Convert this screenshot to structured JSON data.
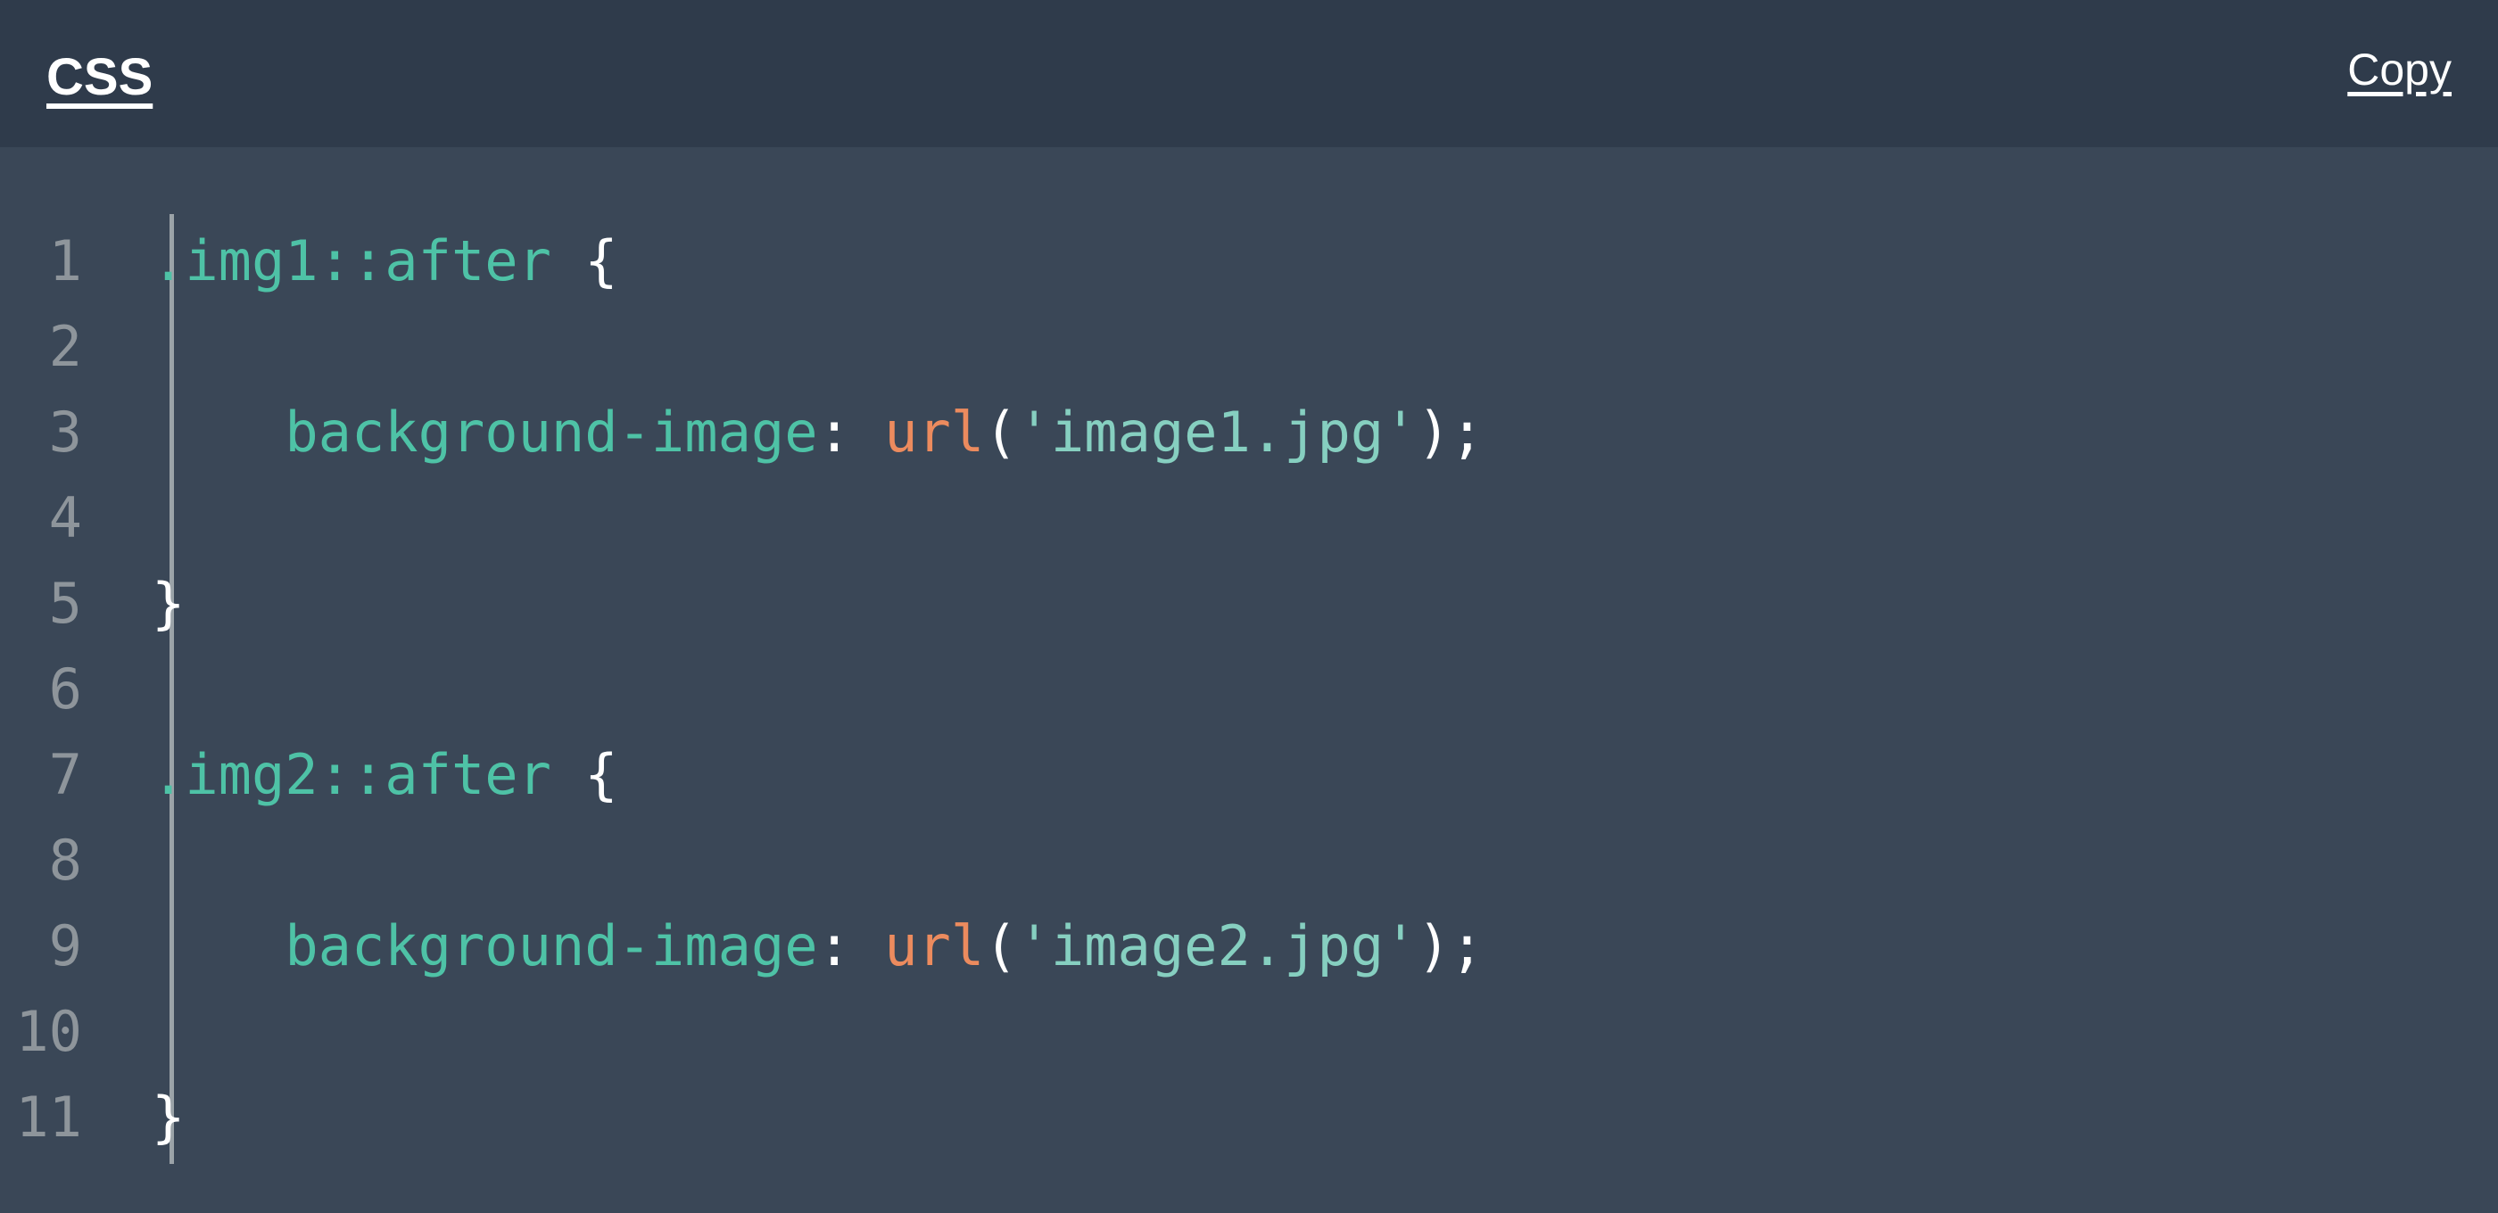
{
  "header": {
    "language_label": "CSS",
    "copy_label": "Copy"
  },
  "colors": {
    "header_background": "#2f3b4b",
    "code_background": "#3a4757",
    "line_number": "#8e959b",
    "gutter_rule": "#9ba3a8",
    "selector": "#4ec2a6",
    "property": "#4ec2a6",
    "function": "#ec8b5e",
    "string": "#86cfc0",
    "punctuation": "#ffffff"
  },
  "code": {
    "language": "CSS",
    "line_numbers": [
      "1",
      "2",
      "3",
      "4",
      "5",
      "6",
      "7",
      "8",
      "9",
      "10",
      "11"
    ],
    "lines": [
      {
        "number": "1",
        "text": ".img1::after {"
      },
      {
        "number": "2",
        "text": ""
      },
      {
        "number": "3",
        "text": "    background-image: url('image1.jpg');"
      },
      {
        "number": "4",
        "text": ""
      },
      {
        "number": "5",
        "text": "}"
      },
      {
        "number": "6",
        "text": ""
      },
      {
        "number": "7",
        "text": ".img2::after {"
      },
      {
        "number": "8",
        "text": ""
      },
      {
        "number": "9",
        "text": "    background-image: url('image2.jpg');"
      },
      {
        "number": "10",
        "text": ""
      },
      {
        "number": "11",
        "text": "}"
      }
    ],
    "tokens": {
      "selector_1": ".img1::after",
      "selector_2": ".img2::after",
      "brace_open": " {",
      "brace_close": "}",
      "property": "background-image",
      "colon": ": ",
      "function": "url",
      "paren_open": "(",
      "string_1": "'image1.jpg'",
      "string_2": "'image2.jpg'",
      "paren_close_semicolon": ");",
      "indent": "    "
    }
  }
}
